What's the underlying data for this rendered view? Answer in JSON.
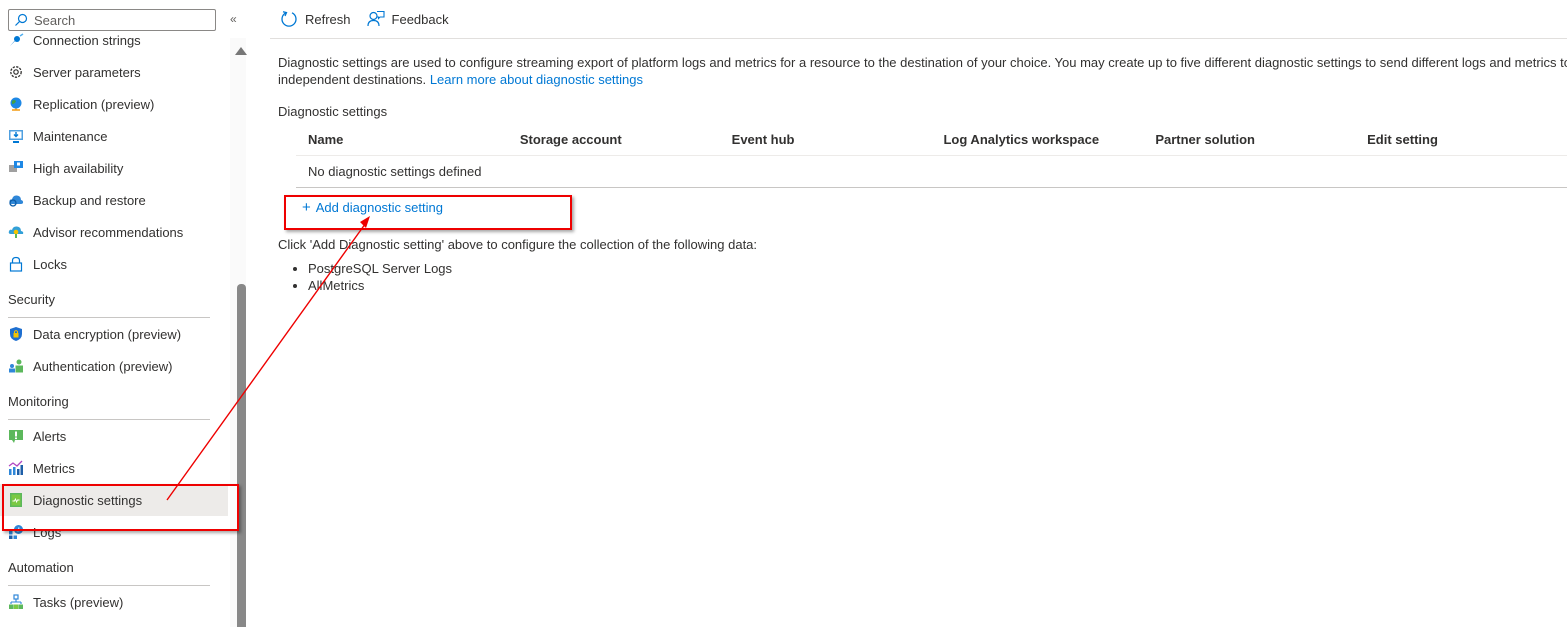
{
  "sidebar": {
    "search_placeholder": "Search",
    "collapse_glyph": "«",
    "items_top": [
      {
        "label": "Connection strings",
        "icon": "connection-strings-icon"
      },
      {
        "label": "Server parameters",
        "icon": "gear-icon"
      },
      {
        "label": "Replication (preview)",
        "icon": "globe-icon"
      },
      {
        "label": "Maintenance",
        "icon": "maintenance-monitor-icon"
      },
      {
        "label": "High availability",
        "icon": "high-availability-icon"
      },
      {
        "label": "Backup and restore",
        "icon": "backup-cloud-icon"
      },
      {
        "label": "Advisor recommendations",
        "icon": "advisor-icon"
      },
      {
        "label": "Locks",
        "icon": "lock-icon"
      }
    ],
    "sections": [
      {
        "title": "Security",
        "items": [
          {
            "label": "Data encryption (preview)",
            "icon": "shield-lock-icon"
          },
          {
            "label": "Authentication (preview)",
            "icon": "users-icon"
          }
        ]
      },
      {
        "title": "Monitoring",
        "items": [
          {
            "label": "Alerts",
            "icon": "alert-icon"
          },
          {
            "label": "Metrics",
            "icon": "metrics-chart-icon"
          },
          {
            "label": "Diagnostic settings",
            "icon": "diagnostic-settings-icon",
            "selected": true
          },
          {
            "label": "Logs",
            "icon": "logs-icon"
          }
        ]
      },
      {
        "title": "Automation",
        "items": [
          {
            "label": "Tasks (preview)",
            "icon": "tasks-icon"
          }
        ]
      }
    ]
  },
  "toolbar": {
    "refresh_label": "Refresh",
    "feedback_label": "Feedback"
  },
  "main": {
    "description": "Diagnostic settings are used to configure streaming export of platform logs and metrics for a resource to the destination of your choice. You may create up to five different diagnostic settings to send different logs and metrics to independent destinations.",
    "learn_more_link": "Learn more about diagnostic settings",
    "section_title": "Diagnostic settings",
    "table": {
      "columns": [
        "Name",
        "Storage account",
        "Event hub",
        "Log Analytics workspace",
        "Partner solution",
        "Edit setting"
      ],
      "empty_message": "No diagnostic settings defined"
    },
    "add_button_label": "Add diagnostic setting",
    "hint": "Click 'Add Diagnostic setting' above to configure the collection of the following data:",
    "data_items": [
      "PostgreSQL Server Logs",
      "AllMetrics"
    ]
  },
  "colors": {
    "accent": "#0078d4",
    "annotation": "#ee0000",
    "selected_bg": "#edebe9"
  }
}
